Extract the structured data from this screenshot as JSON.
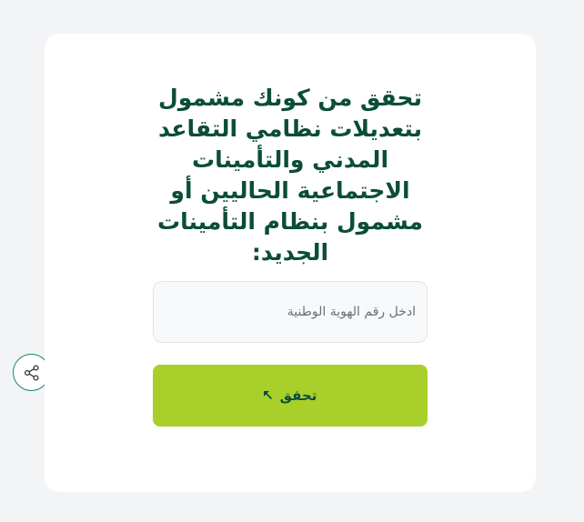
{
  "card": {
    "heading": "تحقق من كونك مشمول بتعديلات نظامي التقاعد المدني والتأمينات الاجتماعية الحاليين أو مشمول بنظام التأمينات الجديد:"
  },
  "id_field": {
    "placeholder": "ادخل رقم الهوية الوطنية",
    "value": ""
  },
  "verify_button": {
    "label": "تحقق",
    "icon": "arrow-up-left-icon"
  },
  "share_button": {
    "icon": "share-icon"
  },
  "colors": {
    "background": "#f3f4f6",
    "card": "#ffffff",
    "heading_text": "#0b4d3a",
    "button_bg": "#a8cf2a",
    "share_border": "#0f8a6e"
  }
}
